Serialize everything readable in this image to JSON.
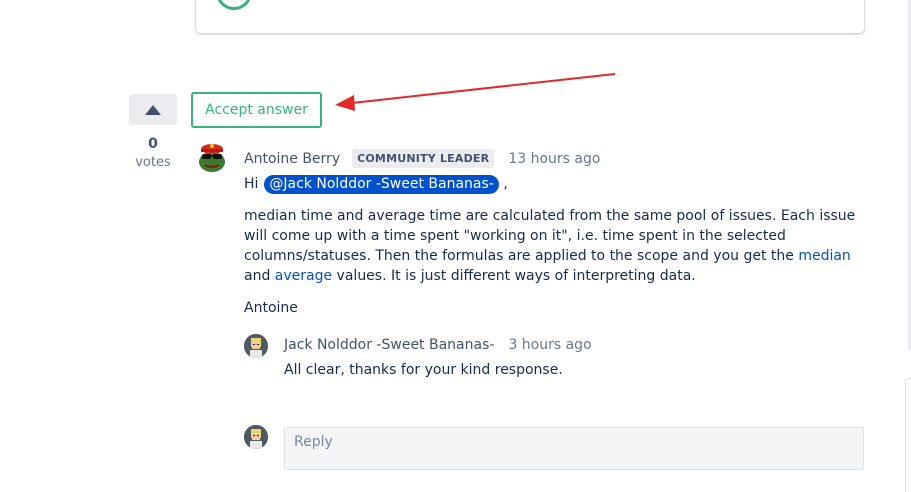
{
  "accept_button": {
    "label": "Accept answer"
  },
  "votes": {
    "count": "0",
    "label": "votes"
  },
  "answer": {
    "author": "Antoine Berry",
    "badge": "COMMUNITY LEADER",
    "timestamp": "13 hours ago",
    "greeting": "Hi",
    "mention": "@Jack Nolddor -Sweet Bananas-",
    "greeting_suffix": ",",
    "paragraph_part1": "median time and average time are calculated from the same pool of issues. Each issue will come up with a time spent \"working on it\", i.e. time spent in the selected columns/statuses. Then the formulas are applied to the scope and you get the ",
    "link_median": "median",
    "paragraph_and": " and ",
    "link_average": "average",
    "paragraph_part2": " values. It is just different ways of interpreting data.",
    "signature": "Antoine"
  },
  "reply": {
    "author": "Jack Nolddor -Sweet Bananas-",
    "timestamp": "3 hours ago",
    "text": "All clear, thanks for your kind response."
  },
  "reply_box": {
    "placeholder": "Reply"
  },
  "colors": {
    "accept_green": "#36b37e",
    "link_blue": "#0052cc",
    "annotation_red": "#e32a2a"
  }
}
